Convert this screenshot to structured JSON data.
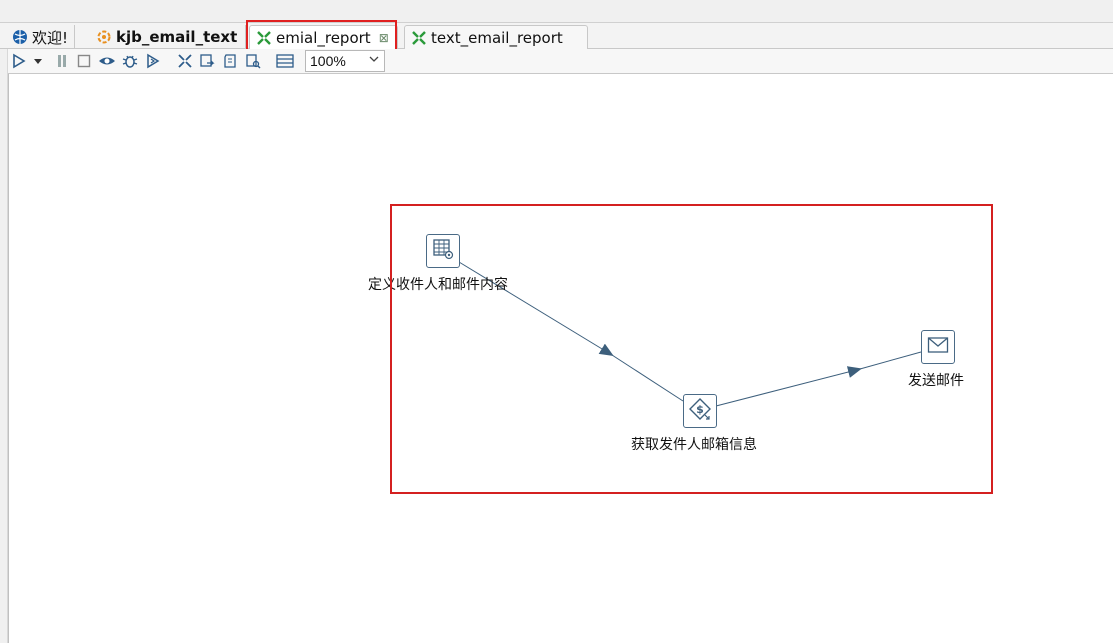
{
  "tabs": [
    {
      "label": "欢迎!",
      "icon": "globe-icon"
    },
    {
      "label": "kjb_email_text",
      "icon": "job-icon"
    },
    {
      "label": "emial_report",
      "icon": "transformation-icon",
      "active": true,
      "close": "⊠"
    },
    {
      "label": "text_email_report",
      "icon": "transformation-icon"
    }
  ],
  "toolbar": {
    "zoom_value": "100%"
  },
  "canvas": {
    "nodes": [
      {
        "label": "定义收件人和邮件内容",
        "icon": "table-input-icon"
      },
      {
        "label": "获取发件人邮箱信息",
        "icon": "variable-icon"
      },
      {
        "label": "发送邮件",
        "icon": "mail-icon"
      }
    ]
  },
  "colors": {
    "highlight": "#d42020",
    "hop": "#3d5f7c"
  }
}
